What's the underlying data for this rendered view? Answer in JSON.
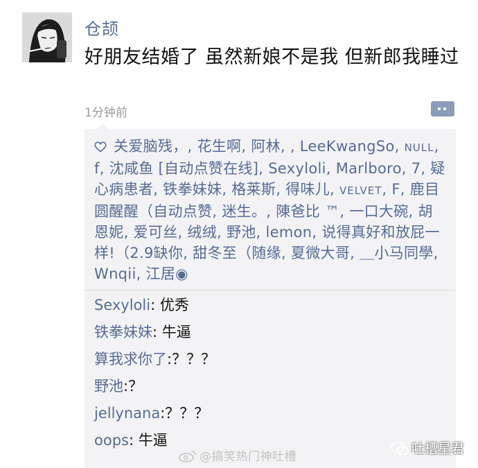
{
  "post": {
    "author": "仓颉",
    "text": "好朋友结婚了 虽然新娘不是我 但新郎我睡过",
    "time": "1分钟前"
  },
  "likes": {
    "icon": "heart-icon",
    "segments": [
      {
        "t": "关爱脑残，, 花生啊, 阿林, , LeeKwangSo, ",
        "sc": false
      },
      {
        "t": "NULL",
        "sc": true
      },
      {
        "t": ", f, 沈咸鱼 [自动点赞在线], Sexyloli, Marlboro, 7, 疑心病患者, 铁拳妹妹, 格莱斯, 得味儿, ",
        "sc": false
      },
      {
        "t": "VELVET",
        "sc": true
      },
      {
        "t": ", F, 鹿目圆醒醒（自动点赞, 迷生。, 陳爸比 ™, 一口大碗, 胡恩妮, 爱可丝, 绒绒, 野池, lemon, 说得真好和放屁一样!（2.9缺你, 甜冬至（随缘, 夏微大哥, ＿小马同學, Wnqii, 江居◉",
        "sc": false
      }
    ]
  },
  "comments": [
    {
      "name": "Sexyloli",
      "text": ": 优秀"
    },
    {
      "name": "铁拳妹妹",
      "text": ": 牛逼"
    },
    {
      "name": "算我求你了",
      "text": ":？？？"
    },
    {
      "name": "野池",
      "text": ":？"
    },
    {
      "name": "jellynana",
      "text": ":？？？"
    },
    {
      "name": "oops",
      "text": ": 牛逼"
    }
  ],
  "watermarks": {
    "weibo": "@搞笑热门神吐槽",
    "wechat": "吐槽星君"
  },
  "colors": {
    "link": "#576b95",
    "panel_bg": "#f3f3f5",
    "comment_button": "#8b9bb9"
  }
}
